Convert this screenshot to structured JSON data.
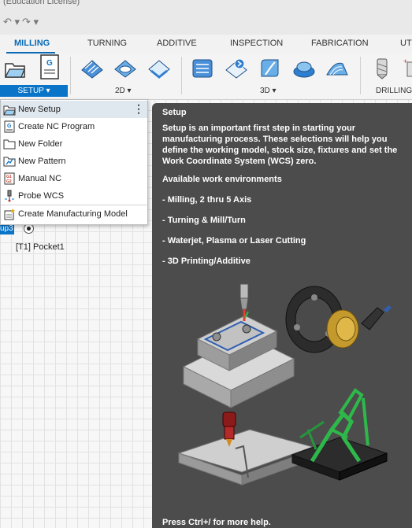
{
  "window": {
    "title": "(Education License)"
  },
  "tabs": [
    {
      "label": "MILLING",
      "active": true
    },
    {
      "label": "TURNING"
    },
    {
      "label": "ADDITIVE"
    },
    {
      "label": "INSPECTION"
    },
    {
      "label": "FABRICATION"
    },
    {
      "label": "UTI"
    }
  ],
  "ribbon": {
    "groups": {
      "setup": "SETUP ▾",
      "two_d": "2D ▾",
      "three_d": "3D ▾",
      "drilling": "DRILLING"
    }
  },
  "setup_menu": {
    "items": [
      {
        "label": "New Setup",
        "icon": "new-setup-icon",
        "more": "⋮"
      },
      {
        "label": "Create NC Program",
        "icon": "nc-program-icon"
      },
      {
        "label": "New Folder",
        "icon": "folder-icon"
      },
      {
        "label": "New Pattern",
        "icon": "pattern-icon"
      },
      {
        "label": "Manual NC",
        "icon": "manual-nc-icon"
      },
      {
        "label": "Probe WCS",
        "icon": "probe-icon"
      },
      {
        "label": "Create Manufacturing Model",
        "icon": "manufacturing-model-icon"
      }
    ]
  },
  "browser": {
    "setup_tag": "up3",
    "operation": "[T1] Pocket1"
  },
  "tooltip": {
    "title": "Setup",
    "description": "Setup is an important first step in starting your manufacturing process. These selections will help you define the working model, stock size, fixtures and set the Work Coordinate System (WCS) zero.",
    "subtitle": "Available work environments",
    "environments": [
      "- Milling, 2 thru 5 Axis",
      "- Turning & Mill/Turn",
      "- Waterjet, Plasma or Laser Cutting",
      "- 3D Printing/Additive"
    ],
    "footer": "Press Ctrl+/ for more help."
  },
  "colors": {
    "accent": "#0a74c8",
    "tooltip_bg": "#4c4c4c"
  }
}
